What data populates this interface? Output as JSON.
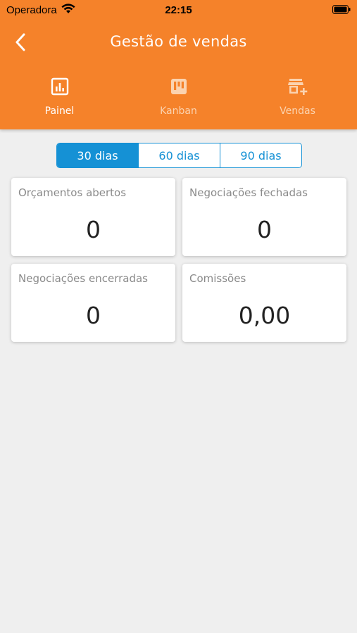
{
  "status_bar": {
    "carrier": "Operadora",
    "time": "22:15"
  },
  "header": {
    "title": "Gestão de vendas",
    "background_color": "#f5822a"
  },
  "tabs": [
    {
      "label": "Painel",
      "icon": "chart-icon",
      "active": true
    },
    {
      "label": "Kanban",
      "icon": "kanban-icon",
      "active": false
    },
    {
      "label": "Vendas",
      "icon": "store-add-icon",
      "active": false
    }
  ],
  "period_filter": {
    "options": [
      "30 dias",
      "60 dias",
      "90 dias"
    ],
    "selected": "30 dias",
    "accent_color": "#1591d5"
  },
  "cards": [
    {
      "label": "Orçamentos abertos",
      "value": "0"
    },
    {
      "label": "Negociações fechadas",
      "value": "0"
    },
    {
      "label": "Negociações encerradas",
      "value": "0"
    },
    {
      "label": "Comissões",
      "value": "0,00"
    }
  ]
}
